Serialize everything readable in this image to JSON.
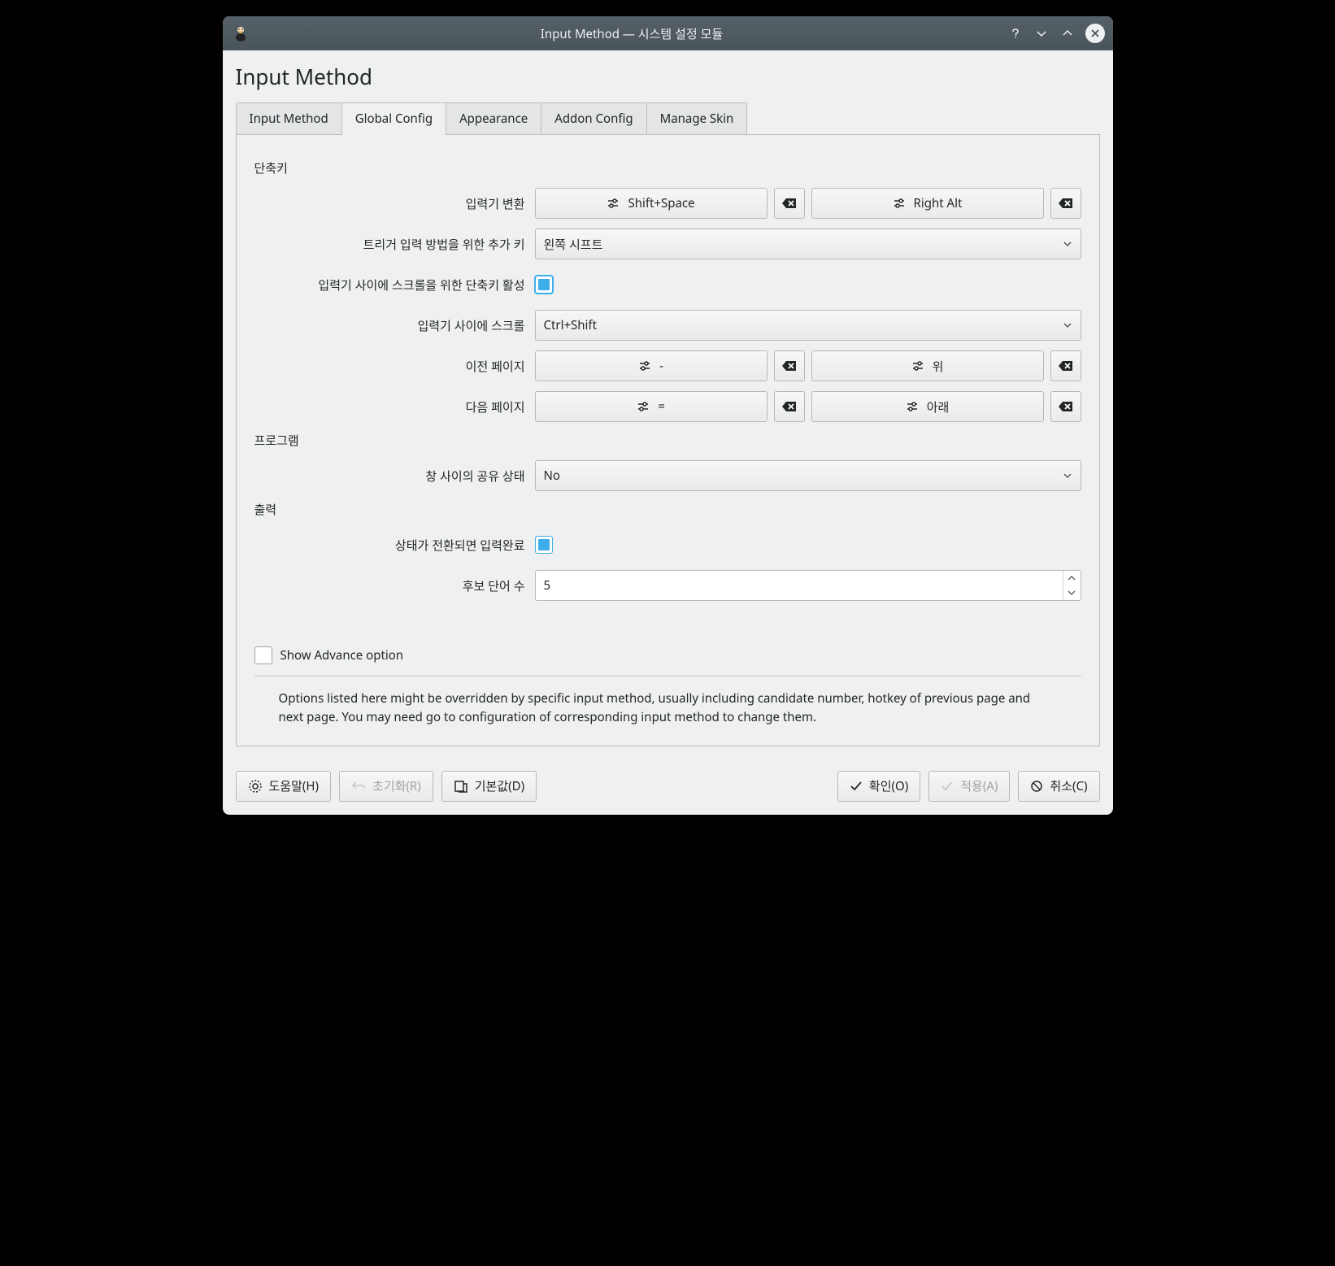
{
  "titlebar": {
    "title": "Input Method — 시스템 설정 모듈"
  },
  "page": {
    "title": "Input Method"
  },
  "tabs": {
    "items": [
      {
        "label": "Input Method"
      },
      {
        "label": "Global Config"
      },
      {
        "label": "Appearance"
      },
      {
        "label": "Addon Config"
      },
      {
        "label": "Manage Skin"
      }
    ],
    "active_index": 1
  },
  "sections": {
    "hotkey": {
      "title": "단축키",
      "rows": {
        "trigger": {
          "label": "입력기 변환",
          "value1": "Shift+Space",
          "value2": "Right Alt"
        },
        "extra_trigger": {
          "label": "트리거 입력 방법을 위한 추가 키",
          "value": "왼쪽 시프트"
        },
        "enable_scroll": {
          "label": "입력기 사이에 스크롤을 위한 단축키 활성",
          "checked": true
        },
        "scroll_between": {
          "label": "입력기 사이에 스크롤",
          "value": "Ctrl+Shift"
        },
        "prev_page": {
          "label": "이전 페이지",
          "value1": "-",
          "value2": "위"
        },
        "next_page": {
          "label": "다음 페이지",
          "value1": "=",
          "value2": "아래"
        }
      }
    },
    "program": {
      "title": "프로그램",
      "rows": {
        "share_state": {
          "label": "창 사이의 공유 상태",
          "value": "No"
        }
      }
    },
    "output": {
      "title": "출력",
      "rows": {
        "commit_on_toggle": {
          "label": "상태가 전환되면 입력완료",
          "checked": true
        },
        "candidate_count": {
          "label": "후보 단어 수",
          "value": "5"
        }
      }
    }
  },
  "show_advance": {
    "label": "Show Advance option",
    "checked": false
  },
  "info_text": "Options listed here might be overridden by specific input method, usually including candidate number, hotkey of previous page and next page. You may need go to configuration of corresponding input method to change them.",
  "footer": {
    "help": "도움말(H)",
    "reset": "초기화(R)",
    "defaults": "기본값(D)",
    "ok": "확인(O)",
    "apply": "적용(A)",
    "cancel": "취소(C)"
  }
}
